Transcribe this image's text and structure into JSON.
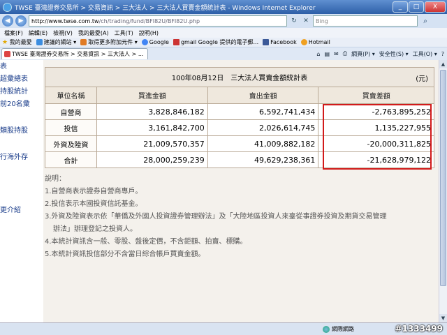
{
  "window": {
    "title": "TWSE 臺灣證券交易所 > 交易資訊 > 三大法人 > 三大法人買賣金額統計表 - Windows Internet Explorer",
    "minimize": "_",
    "maximize": "□",
    "close": "X"
  },
  "address": {
    "url_host": "http://www.twse.com.tw",
    "url_path": "/ch/trading/fund/BFI82U/BFI82U.php",
    "search_placeholder": "Bing"
  },
  "menu": [
    "檔案(F)",
    "編輯(E)",
    "檢視(V)",
    "我的最愛(A)",
    "工具(T)",
    "說明(H)"
  ],
  "favorites": {
    "label": "我的最愛",
    "items": [
      "建議的網站 ▾",
      "取得更多附加元件 ▾",
      "Google",
      "gmail Google 提供的電子郵...",
      "Facebook",
      "Hotmail"
    ]
  },
  "tab": {
    "label": "TWSE 臺灣證券交易所 > 交易資訊 > 三大法人 > ..."
  },
  "commands": [
    "網頁(P) ▾",
    "安全性(S) ▾",
    "工具(O) ▾"
  ],
  "leftnav": [
    "表",
    "超彙總表",
    "持股統計",
    "前20名彙",
    "類股持股",
    "行海外存",
    "更介紹"
  ],
  "table": {
    "caption": "100年08月12日　三大法人買賣金額統計表",
    "unit": "(元)",
    "headers": [
      "單位名稱",
      "買進金額",
      "賣出金額",
      "買賣差額"
    ],
    "rows": [
      {
        "name": "自營商",
        "buy": "3,828,846,182",
        "sell": "6,592,741,434",
        "diff": "-2,763,895,252"
      },
      {
        "name": "投信",
        "buy": "3,161,842,700",
        "sell": "2,026,614,745",
        "diff": "1,135,227,955"
      },
      {
        "name": "外資及陸資",
        "buy": "21,009,570,357",
        "sell": "41,009,882,182",
        "diff": "-20,000,311,825"
      },
      {
        "name": "合計",
        "buy": "28,000,259,239",
        "sell": "49,629,238,361",
        "diff": "-21,628,979,122"
      }
    ]
  },
  "notes": {
    "heading": "說明：",
    "items": [
      "1.自營商表示證券自營商專戶。",
      "2.投信表示本國投資信託基金。",
      "3.外資及陸資表示依「華僑及外國人投資證券管理辦法」及「大陸地區投資人來臺從事證券投資及期貨交易管理",
      "辦法」辦理登記之投資人。",
      "4.本統計資訊含一般、零股、盤後定價，不含鉅額、拍賣、標購。",
      "5.本統計資訊投信部分不含當日綜合帳戶買賣金額。"
    ]
  },
  "status": {
    "zone": "網際網路",
    "watermark": "#1333499"
  }
}
